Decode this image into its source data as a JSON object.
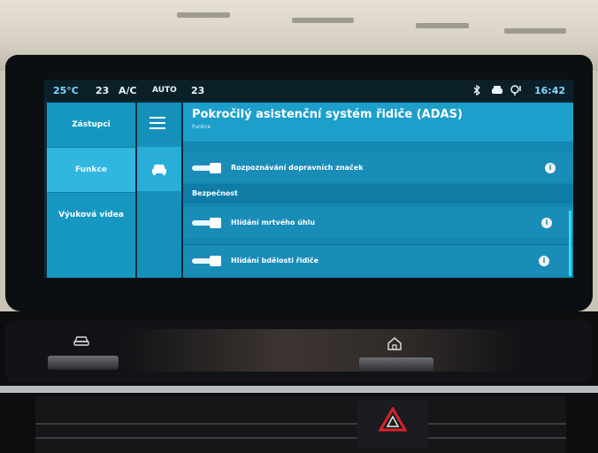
{
  "status_bar": {
    "temp_outside": "25°C",
    "temp_left": "23",
    "ac_label": "A/C",
    "auto_label": "AUTO",
    "temp_right": "23",
    "bluetooth_icon": "bluetooth-icon",
    "car_icon": "car-icon",
    "location_icon": "location-icon",
    "time": "16:42"
  },
  "nav": {
    "items": [
      {
        "label": "Zástupci",
        "active": false
      },
      {
        "label": "Funkce",
        "active": true
      },
      {
        "label": "Výuková videa",
        "active": false
      }
    ]
  },
  "rail": {
    "menu_icon": "hamburger-menu-icon",
    "car_icon": "car-functions-icon"
  },
  "header": {
    "title": "Pokročilý asistenční systém řidiče (ADAS)",
    "subtitle": "Funkce"
  },
  "rows": [
    {
      "label": "Rozpoznávání dopravních značek",
      "enabled": true
    },
    {
      "label": "Hlídání mrtvého úhlu",
      "enabled": true
    },
    {
      "label": "Hlídání bdělosti řidiče",
      "enabled": true
    }
  ],
  "section": {
    "label": "Bezpečnost"
  },
  "info_glyph": "i",
  "colors": {
    "accent": "#1d9fcb",
    "nav_active": "#31b6e0",
    "status_text": "#7fd8ff",
    "scroll_indicator": "#2fe0e8",
    "hazard_red": "#d8222a"
  },
  "hardware": {
    "car_button_icon": "car-icon",
    "home_button_icon": "home-icon",
    "hazard_icon": "hazard-warning-icon"
  }
}
